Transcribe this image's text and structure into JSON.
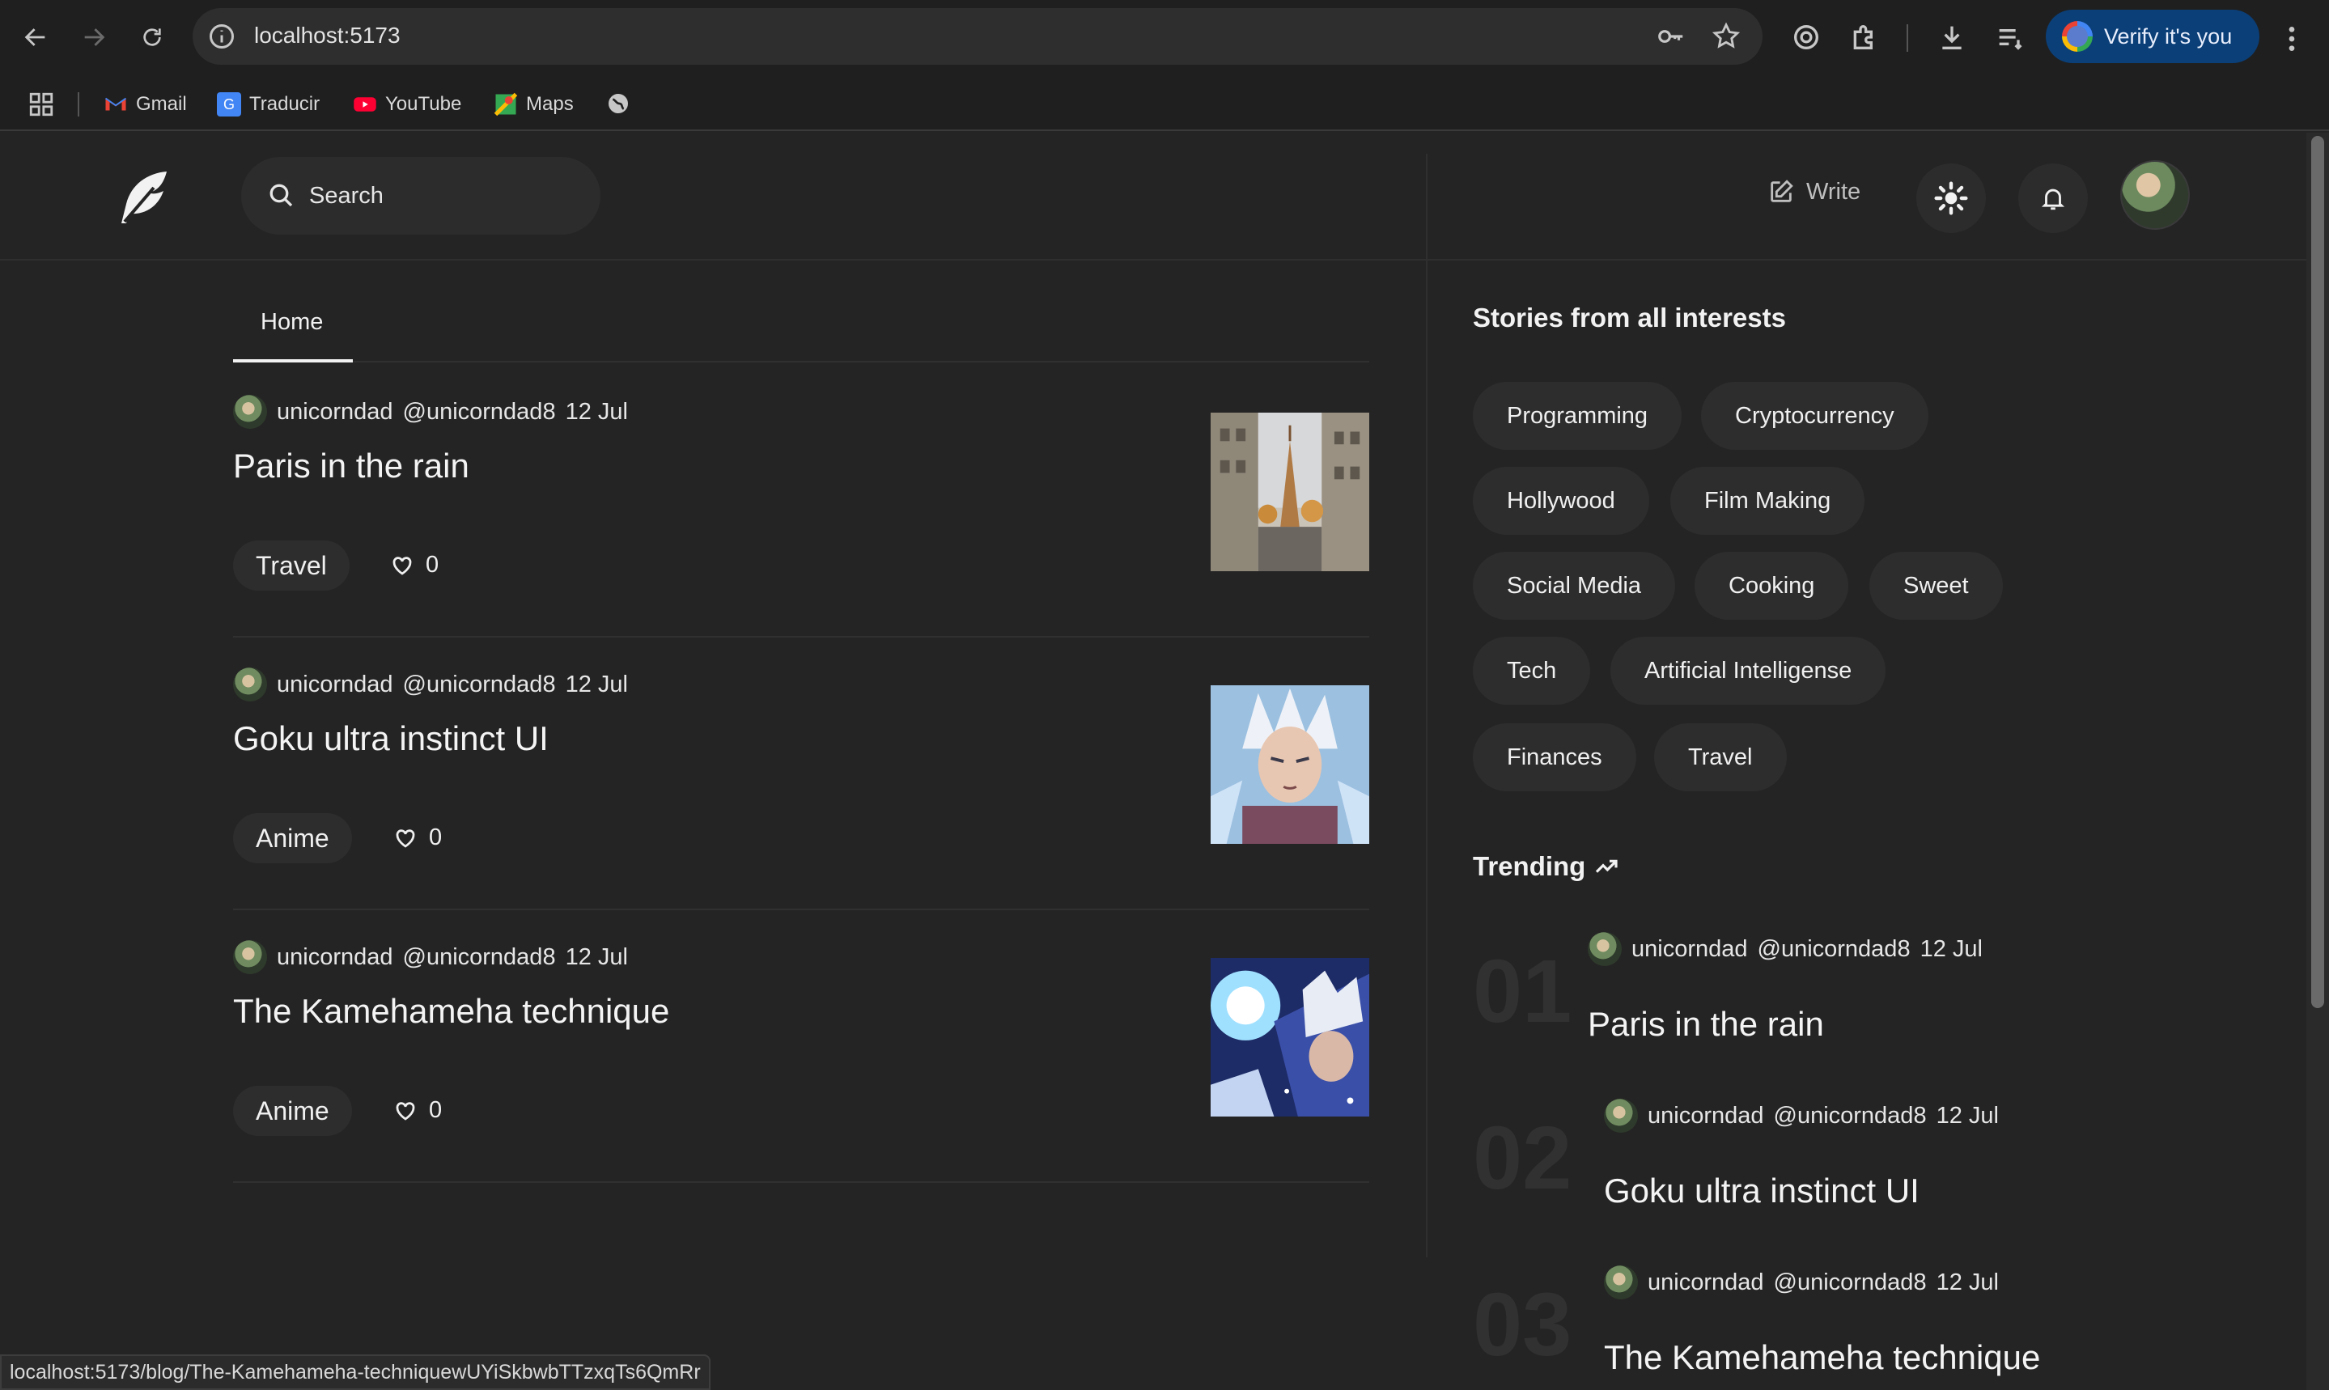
{
  "browser": {
    "url": "localhost:5173",
    "verify_label": "Verify it's you",
    "bookmarks": [
      {
        "label": "Gmail",
        "icon": "gmail-icon"
      },
      {
        "label": "Traducir",
        "icon": "translate-icon"
      },
      {
        "label": "YouTube",
        "icon": "youtube-icon"
      },
      {
        "label": "Maps",
        "icon": "maps-icon"
      }
    ],
    "status_url": "localhost:5173/blog/The-Kamehameha-techniquewUYiSkbwbTTzxqTs6QmRr"
  },
  "header": {
    "search_placeholder": "Search",
    "write_label": "Write"
  },
  "tabs": {
    "home": "Home"
  },
  "posts": [
    {
      "author": "unicorndad",
      "handle": "@unicorndad8",
      "date": "12 Jul",
      "title": "Paris in the rain",
      "tag": "Travel",
      "likes": "0"
    },
    {
      "author": "unicorndad",
      "handle": "@unicorndad8",
      "date": "12 Jul",
      "title": "Goku ultra instinct UI",
      "tag": "Anime",
      "likes": "0"
    },
    {
      "author": "unicorndad",
      "handle": "@unicorndad8",
      "date": "12 Jul",
      "title": "The Kamehameha technique",
      "tag": "Anime",
      "likes": "0"
    }
  ],
  "sidebar": {
    "interests_heading": "Stories from all interests",
    "interests": [
      "Programming",
      "Cryptocurrency",
      "Hollywood",
      "Film Making",
      "Social Media",
      "Cooking",
      "Sweet",
      "Tech",
      "Artificial Intelligense",
      "Finances",
      "Travel"
    ],
    "trending_heading": "Trending",
    "trending": [
      {
        "num": "01",
        "author": "unicorndad",
        "handle": "@unicorndad8",
        "date": "12 Jul",
        "title": "Paris in the rain"
      },
      {
        "num": "02",
        "author": "unicorndad",
        "handle": "@unicorndad8",
        "date": "12 Jul",
        "title": "Goku ultra instinct UI"
      },
      {
        "num": "03",
        "author": "unicorndad",
        "handle": "@unicorndad8",
        "date": "12 Jul",
        "title": "The Kamehameha technique"
      }
    ]
  }
}
